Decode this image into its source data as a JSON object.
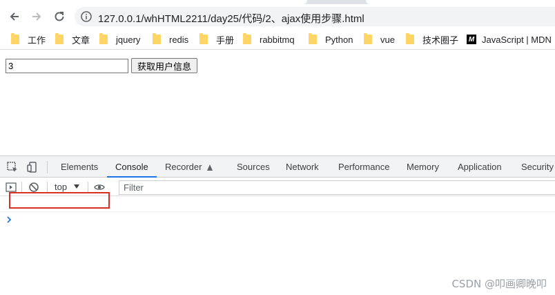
{
  "browser": {
    "url": "127.0.0.1/whHTML2211/day25/代码/2、ajax使用步骤.html"
  },
  "bookmarks": [
    {
      "label": "工作"
    },
    {
      "label": "文章"
    },
    {
      "label": "jquery"
    },
    {
      "label": "redis"
    },
    {
      "label": "手册"
    },
    {
      "label": "rabbitmq"
    },
    {
      "label": "Python"
    },
    {
      "label": "vue"
    },
    {
      "label": "技术圈子"
    },
    {
      "label": "JavaScript | MDN",
      "icon_text": "M"
    }
  ],
  "page": {
    "input_value": "3",
    "button_label": "获取用户信息"
  },
  "devtools": {
    "tabs": [
      "Elements",
      "Console",
      "Recorder",
      "Sources",
      "Network",
      "Performance",
      "Memory",
      "Application",
      "Security"
    ],
    "active_tab": "Console",
    "context": "top",
    "filter_placeholder": "Filter"
  },
  "watermark": "CSDN @叩画卿晚叩",
  "colors": {
    "accent": "#1a73e8",
    "highlight_box": "#d93025"
  }
}
